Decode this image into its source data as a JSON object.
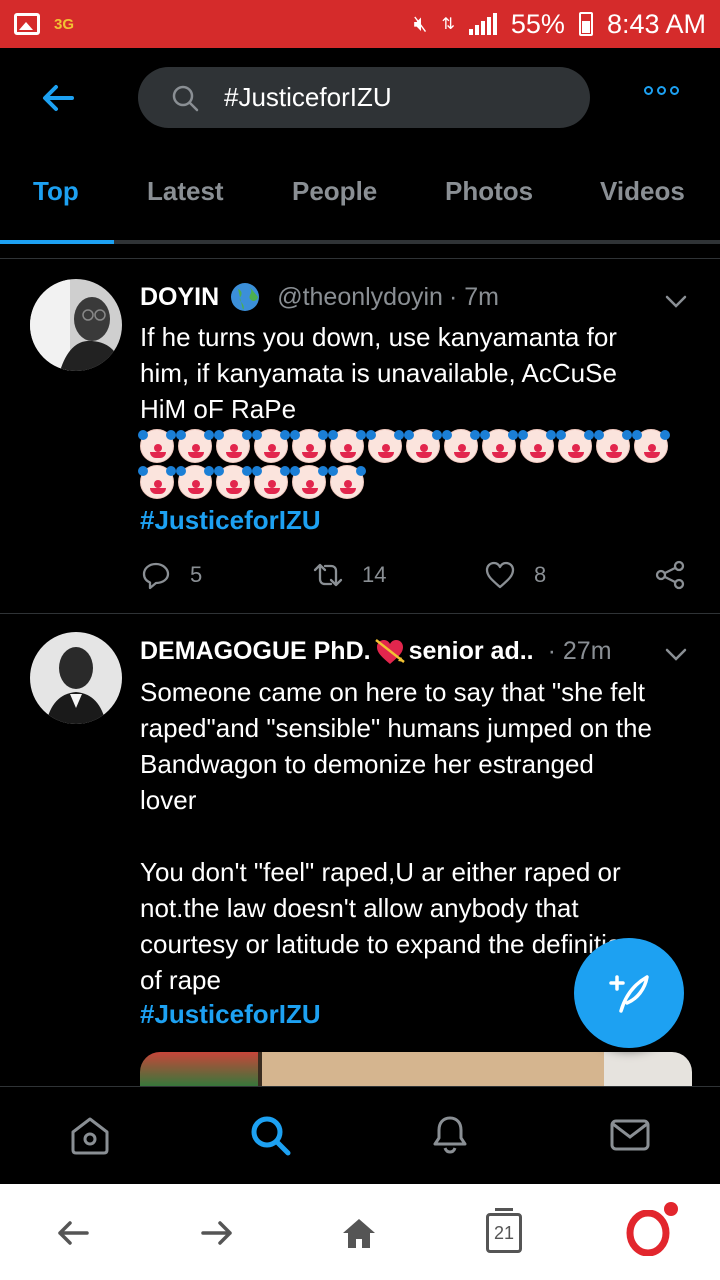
{
  "status_bar": {
    "network": "3G",
    "battery": "55%",
    "time": "8:43 AM",
    "icons": [
      "gallery-icon",
      "mute-icon",
      "data-icon",
      "signal-icon",
      "battery-icon"
    ]
  },
  "header": {
    "search_query": "#JusticeforIZU",
    "back_icon": "arrow-left-icon",
    "more_icon": "more-dots-icon"
  },
  "tabs": [
    {
      "label": "Top",
      "active": true
    },
    {
      "label": "Latest",
      "active": false
    },
    {
      "label": "People",
      "active": false
    },
    {
      "label": "Photos",
      "active": false
    },
    {
      "label": "Videos",
      "active": false
    }
  ],
  "tweets": [
    {
      "name": "DOYIN",
      "handle": "@theonlydoyin",
      "time": "· 7m",
      "body": "If he turns you down, use kanyamanta for\nhim, if kanyamata is unavailable, AcCuSe\nHiM oF RaPe",
      "emoji_rows": [
        14,
        6
      ],
      "hashtag": "#JusticeforIZU",
      "replies": "5",
      "retweets": "14",
      "likes": "8"
    },
    {
      "name": "DEMAGOGUE PhD.",
      "name_suffix": "senior ad..",
      "time": "· 27m",
      "body": "Someone came on here to say that \"she felt\nraped\"and \"sensible\" humans jumped on the\nBandwagon to demonize her estranged\nlover\n\nYou don't \"feel\" raped,U ar either raped or\nnot.the law doesn't allow anybody that\ncourtesy or latitude to expand the definition\nof rape",
      "hashtag": "#JusticeforIZU"
    }
  ],
  "bottom_nav": [
    "home-icon",
    "search-icon",
    "notifications-icon",
    "messages-icon"
  ],
  "browser_bar": {
    "tab_count": "21",
    "icons": [
      "back-arrow-icon",
      "forward-arrow-icon",
      "home-icon",
      "tabs-icon",
      "opera-icon"
    ]
  },
  "colors": {
    "accent": "#1da1f2",
    "status_bar": "#d52b2b",
    "background": "#000000",
    "muted": "#8a8f94"
  }
}
